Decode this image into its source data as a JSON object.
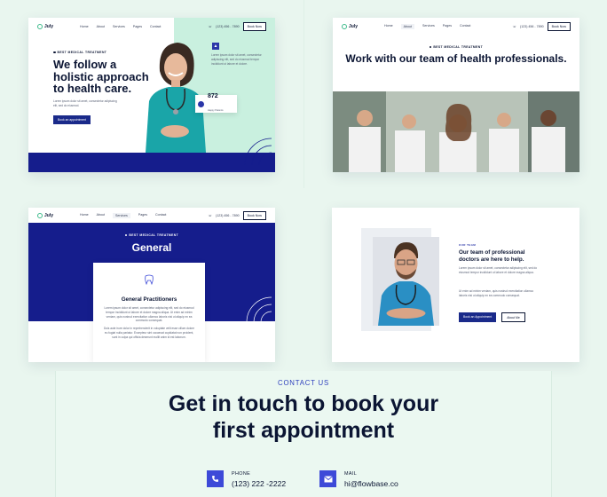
{
  "card_home": {
    "logo": "July",
    "nav": [
      "Home",
      "About",
      "Services",
      "Pages",
      "Contact"
    ],
    "phone": "(123) 456 - 7890",
    "cta": "Book Now",
    "eyebrow": "BEST MEDICAL TREATMENT",
    "headline": "We follow a holistic approach to health care.",
    "description": "Lorem ipsum dolor sit amet, consectetur adipiscing elit, sed do eiusmod.",
    "button": "Book an appointment",
    "side_text": "Lorem ipsum dolor sit amet, consectetur adipiscing elit, sed do eiusmod tempor incididunt ut labore et dolore.",
    "stat_value": "872",
    "stat_label": "Happy Patients"
  },
  "card_team": {
    "logo": "July",
    "nav": [
      "Home",
      "About",
      "Services",
      "Pages",
      "Contact"
    ],
    "phone": "(123) 456 - 7890",
    "cta": "Book Now",
    "eyebrow": "BEST MEDICAL TREATMENT",
    "headline": "Work with our team of health professionals."
  },
  "card_general": {
    "logo": "July",
    "nav": [
      "Home",
      "About",
      "Services",
      "Pages",
      "Contact"
    ],
    "active_nav": "Services",
    "phone": "(123) 456 - 7890",
    "cta": "Book Now",
    "eyebrow": "BEST MEDICAL TREATMENT",
    "headline": "General",
    "box_title": "General Practitioners",
    "box_text_1": "Lorem ipsum dolor sit amet, consectetur adipiscing elit, sed do eiusmod tempor incididunt ut labore et dolore magna aliqua. Ut enim ad minim veniam, quis nostrud exercitation ullamco laboris nisi ut aliquip ex ea commodo consequat.",
    "box_text_2": "Duis aute irure dolor in reprehenderit in voluptate velit esse cillum dolore eu fugiat nulla pariatur. Excepteur sint occaecat cupidatat non proident, sunt in culpa qui officia deserunt mollit anim id est laborum."
  },
  "card_doctors": {
    "eyebrow": "OUR TEAM",
    "headline": "Our team of professional doctors are here to help.",
    "paragraph_1": "Lorem ipsum dolor sit amet, consectetur adipiscing elit, sed do eiusmod tempor incididunt ut labore et dolore magna aliqua.",
    "paragraph_2": "Ut enim ad minim veniam, quis nostrud exercitation ullamco laboris nisi ut aliquip ex ea commodo consequat.",
    "button_primary": "Book an Appointment",
    "button_secondary": "About Me"
  },
  "contact": {
    "eyebrow": "CONTACT US",
    "headline_line1": "Get in touch to book your",
    "headline_line2": "first appointment",
    "phone_label": "PHONE",
    "phone_value": "(123) 222 -2222",
    "mail_label": "MAIL",
    "mail_value": "hi@flowbase.co"
  },
  "colors": {
    "page_bg": "#e9f6ef",
    "navy": "#151d8c",
    "mint": "#c9f0df",
    "accent_blue": "#3d4ad8"
  }
}
